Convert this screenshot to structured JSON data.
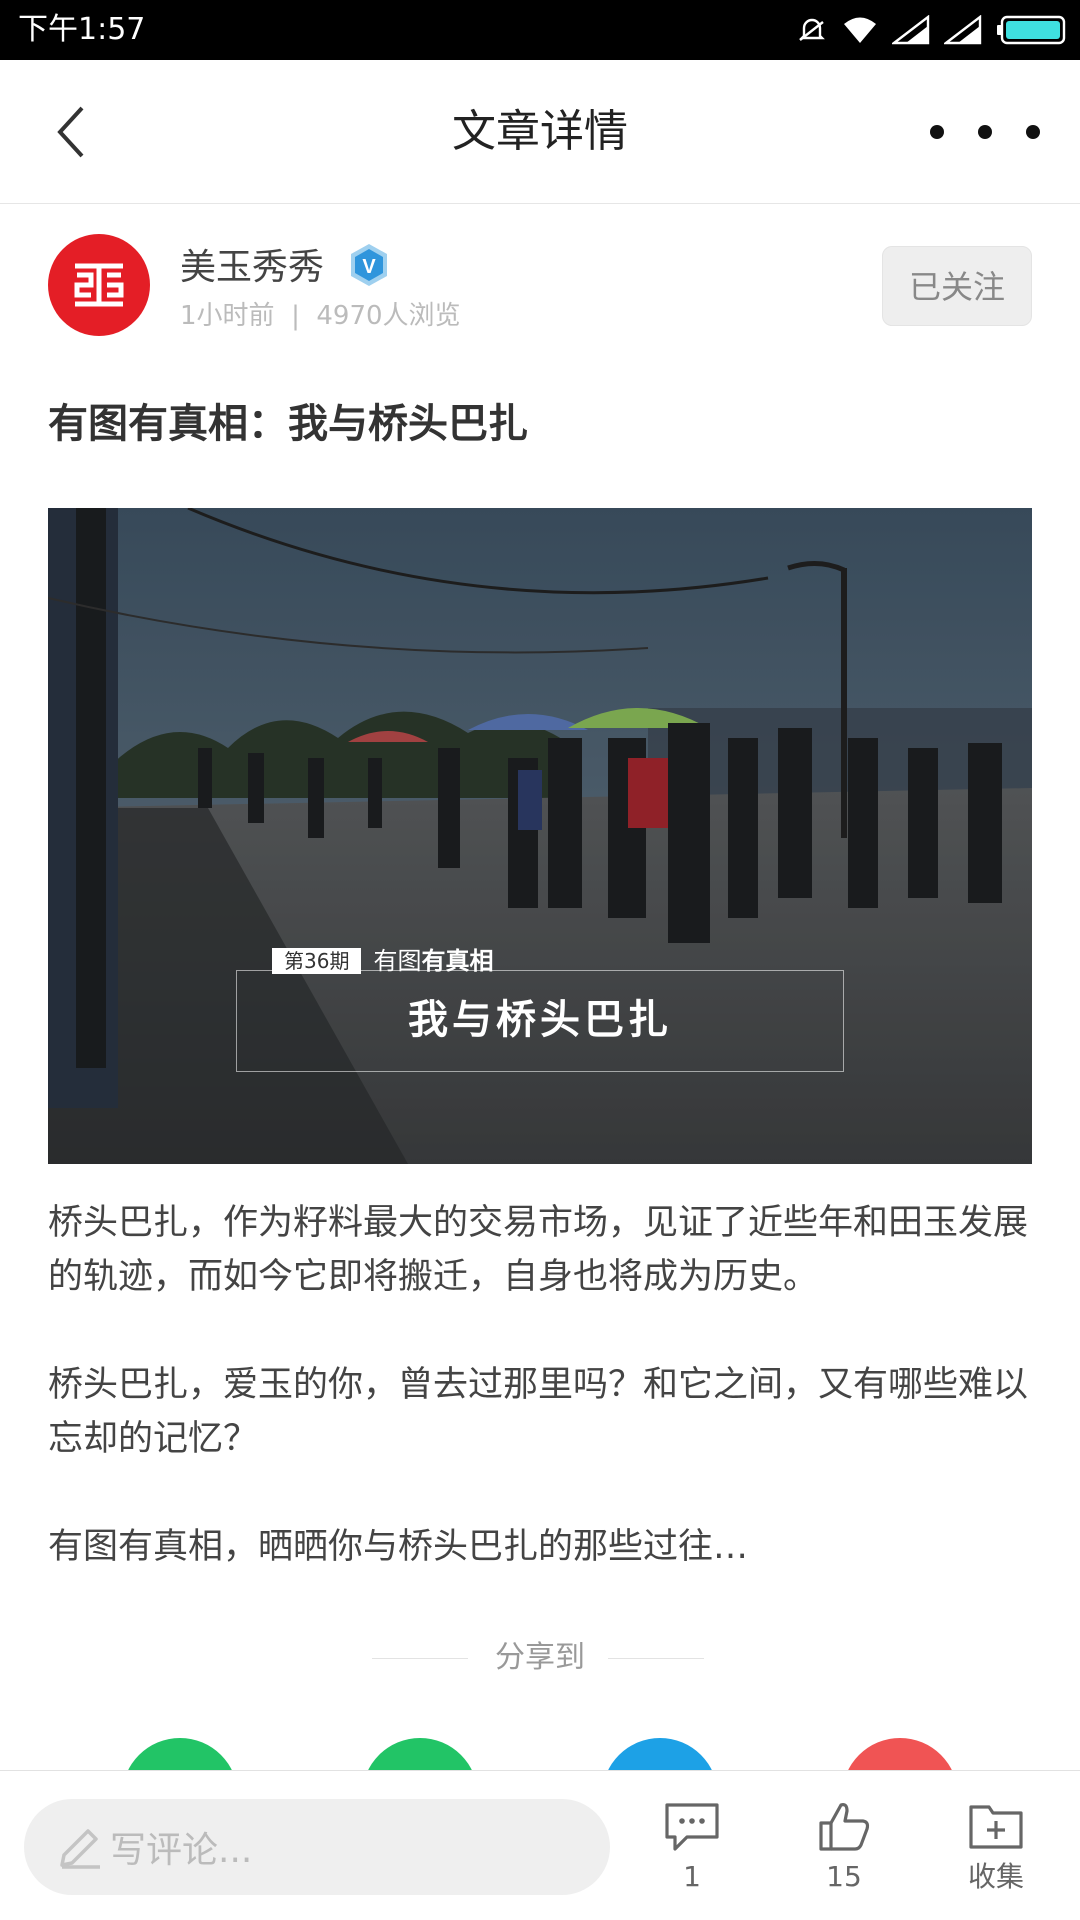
{
  "status_bar": {
    "time": "下午1:57",
    "icons": [
      "alarm-icon",
      "wifi-icon",
      "signal-icon",
      "signal-icon",
      "battery-icon"
    ]
  },
  "nav": {
    "title": "文章详情",
    "back_icon": "chevron-left-icon",
    "more_icon": "more-horizontal-icon"
  },
  "author": {
    "name": "美玉秀秀",
    "verified_badge": "V",
    "meta": "1小时前  |  4970人浏览",
    "follow_label": "已关注",
    "avatar_color": "#e41e26"
  },
  "article": {
    "title": "有图有真相：我与桥头巴扎",
    "hero": {
      "issue_badge": "第36期",
      "series_label": "有图",
      "series_label_strong": "有真相",
      "main_text": "我与桥头巴扎"
    },
    "paragraphs": [
      "桥头巴扎，作为籽料最大的交易市场，见证了近些年和田玉发展的轨迹，而如今它即将搬迁，自身也将成为历史。",
      "桥头巴扎，爱玉的你，曾去过那里吗？和它之间，又有哪些难以忘却的记忆？",
      "有图有真相，晒晒你与桥头巴扎的那些过往…"
    ]
  },
  "share": {
    "label": "分享到",
    "targets": [
      {
        "name": "wechat",
        "color": "#22c466"
      },
      {
        "name": "moments",
        "color": "#22c466"
      },
      {
        "name": "qq",
        "color": "#1da1e6"
      },
      {
        "name": "weibo",
        "color": "#f05454"
      }
    ]
  },
  "bottom_bar": {
    "comment_placeholder": "写评论...",
    "comment_count": "1",
    "like_count": "15",
    "collect_label": "收集"
  }
}
